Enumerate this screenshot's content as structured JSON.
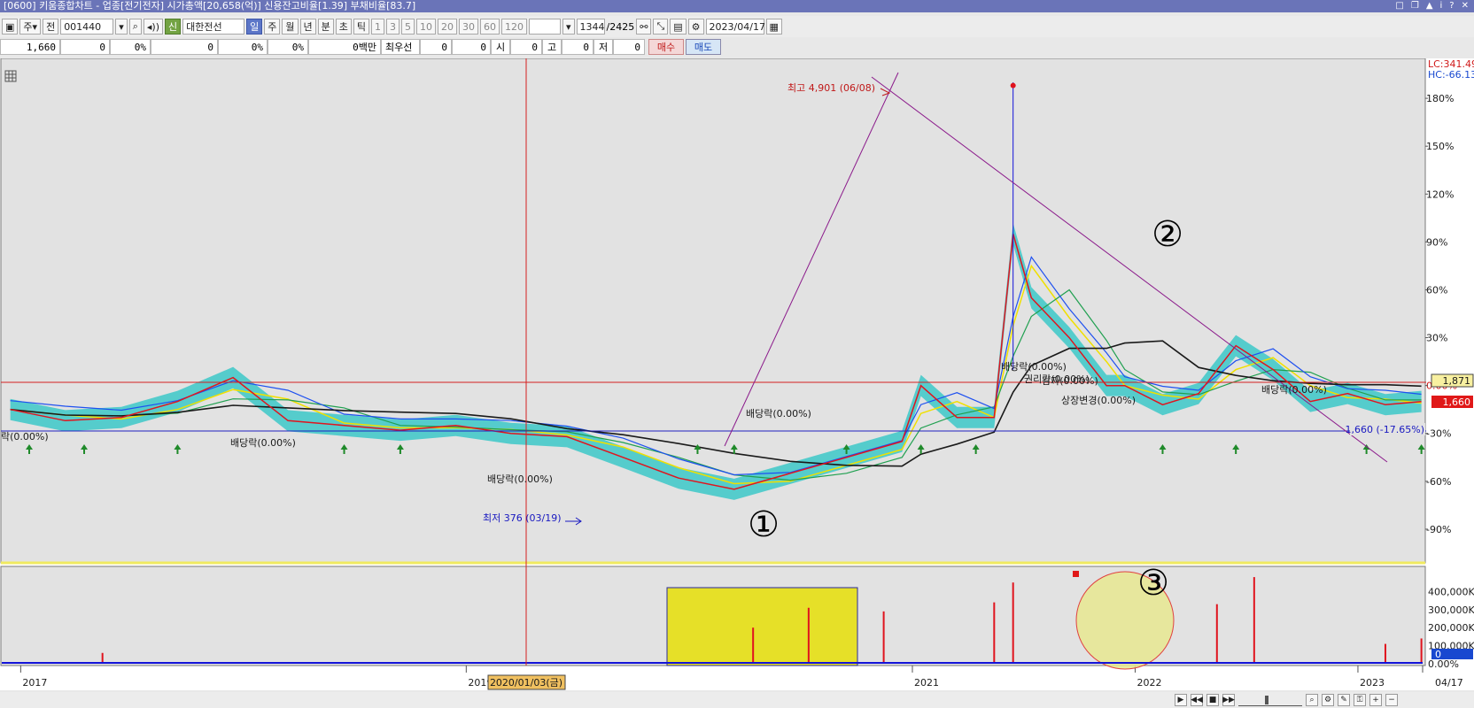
{
  "window": {
    "title": "[0600] 키움종합차트 - 업종[전기전자] 시가총액[20,658(억)] 신용잔고비율[1.39] 부채비율[83.7]",
    "buttons": [
      "□",
      "❐",
      "▲",
      "i",
      "?",
      "✕"
    ]
  },
  "toolbar": {
    "period_mode": "주",
    "prev_label": "전",
    "code_value": "001440",
    "new_badge": "신",
    "stock_name": "대한전선",
    "periods": [
      "일",
      "주",
      "월",
      "년",
      "분",
      "초",
      "틱"
    ],
    "active_period": "일",
    "intervals": [
      "1",
      "3",
      "5",
      "10",
      "20",
      "30",
      "60",
      "120"
    ],
    "count_value": "1344",
    "count_total": "/2425",
    "date_value": "2023/04/17"
  },
  "quote": {
    "price": "1,660",
    "change": "0",
    "change_rate": "0%",
    "volume": "0",
    "volume_rate": "0%",
    "turnover_rate": "0%",
    "amount": "0백만",
    "pref_label": "최우선",
    "pref_value1": "0",
    "pref_value2": "0",
    "open_label": "시",
    "open_value": "0",
    "high_label": "고",
    "high_value": "0",
    "low_label": "저",
    "low_value": "0",
    "buy_label": "매수",
    "sell_label": "매도"
  },
  "colors": {
    "price_up": "#e0141e",
    "price_down": "#1414d8",
    "ma_yellow": "#f0e000",
    "ma_black": "#1a1a1a",
    "ma_blue": "#1e50f0",
    "ma_green": "#20a050",
    "cloud": "#3cc8c8",
    "trendline": "#8b1a8b",
    "highlight_yellow": "#e6e028"
  },
  "chart_data": {
    "type": "line",
    "y_axis_ticks": [
      "180%",
      "150%",
      "120%",
      "90%",
      "60%",
      "30%",
      "0.00%",
      "-30%",
      "-60%",
      "-90%"
    ],
    "y_axis_range": [
      -110,
      205
    ],
    "volume_axis_ticks": [
      "400,000K",
      "300,000K",
      "200,000K",
      "100,000K",
      "0.00%"
    ],
    "x_axis_ticks": [
      "2017",
      "2019",
      "2020/01/03(금)",
      "2021",
      "2022",
      "2023",
      "04/17"
    ],
    "lc_label": "LC:341.49",
    "hc_label": "HC:-66.13",
    "price_tags": [
      "1,871",
      "1,660"
    ],
    "current_price_label": "1,660 (-17.65%)",
    "current_price_short": "1,660",
    "high_annotation": "최고 4,901 (06/08)",
    "low_annotation": "최저 376 (03/19)",
    "dividend_labels": [
      "배당락(0.00%)",
      "배당락(0.00%)",
      "배당락(0.00%)",
      "배당락(0.00%)",
      "배당락(0.00%)",
      "권리락(0.00%)",
      "감자(0.00%)",
      "상장변경(0.00%)",
      "락(0.00%)"
    ],
    "markers": [
      "①",
      "②",
      "③"
    ],
    "price_series": {
      "dates": [
        "2016-12",
        "2017-03",
        "2017-06",
        "2017-09",
        "2017-12",
        "2018-03",
        "2018-06",
        "2018-09",
        "2018-12",
        "2019-03",
        "2019-06",
        "2019-09",
        "2019-12",
        "2020-03",
        "2020-06",
        "2020-09",
        "2020-12",
        "2021-01",
        "2021-03",
        "2021-05",
        "2021-06",
        "2021-07",
        "2021-09",
        "2021-11",
        "2021-12",
        "2022-02",
        "2022-04",
        "2022-06",
        "2022-08",
        "2022-10",
        "2022-12",
        "2023-02",
        "2023-04"
      ],
      "pct": [
        -15,
        -22,
        -20,
        -10,
        5,
        -22,
        -25,
        -28,
        -25,
        -30,
        -32,
        -45,
        -58,
        -65,
        -55,
        -45,
        -35,
        0,
        -20,
        -20,
        95,
        55,
        30,
        0,
        0,
        -12,
        -5,
        25,
        10,
        -10,
        -5,
        -12,
        -10
      ]
    },
    "volume_series": {
      "dates": [
        "2017-05",
        "2020-04",
        "2020-07",
        "2020-11",
        "2021-05",
        "2021-06",
        "2022-05",
        "2022-07",
        "2023-02",
        "2023-04"
      ],
      "values_k": [
        60000,
        200000,
        310000,
        290000,
        340000,
        450000,
        330000,
        480000,
        110000,
        140000
      ]
    }
  }
}
